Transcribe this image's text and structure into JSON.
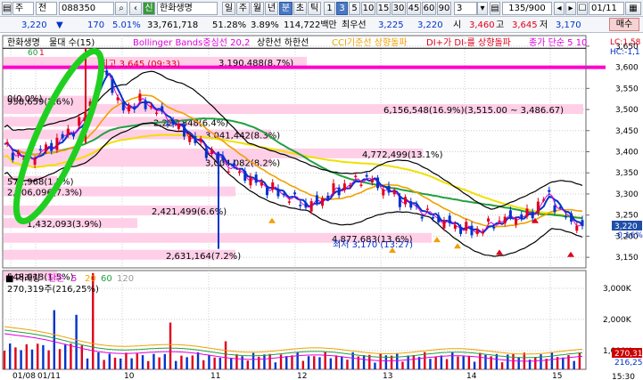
{
  "toolbar": {
    "market_type": "주",
    "period_select": "전",
    "stock_code": "088350",
    "stock_name": "한화생명",
    "period_buttons": [
      "일",
      "주",
      "월",
      "년",
      "분",
      "초",
      "틱"
    ],
    "interval_buttons": [
      "1",
      "3",
      "5",
      "10",
      "15",
      "30",
      "45",
      "60",
      "90"
    ],
    "active_interval": "3",
    "interval_value": "3",
    "count": "135/900",
    "date": "01/11",
    "price": "3,220",
    "change": "170",
    "change_pct": "5.01%",
    "volume": "33,761,718",
    "volume_ratio": "51.28%",
    "turnover": "3.89%",
    "amount": "114,722백만",
    "pref_label": "최우선",
    "ask": "3,225",
    "bid": "3,220",
    "open_label": "시",
    "open": "3,460",
    "high_label": "고",
    "high": "3,645",
    "low_label": "저",
    "low": "3,170",
    "buy_label": "매수"
  },
  "legend": {
    "name": "한화생명",
    "ma_label": "물대 수(15)",
    "ma_values": [
      "60",
      "1"
    ],
    "bollinger": "Bollinger Bands중심선 20,2",
    "upper_lower": "상한선 하한선",
    "cci": "CCI기준선 상향돌파",
    "dmi": "DI+가 DI-를 상향돌파",
    "close_ma": "종가 단순 5 10",
    "lc": "LC:1,58",
    "hc": "HC:-1,1"
  },
  "annotations": {
    "high_marker": "최고 3,645 (09:33)",
    "low_marker": "최저 3,170 (13:27)",
    "zero_label": "0(0.0%)",
    "volume_profile": [
      "3,190,488(8.7%)",
      "6,156,548(16.9%)(3,515.00 ~ 3,486.67)",
      "958,659(2.6%)",
      "2,227,848(6.4%)",
      "3,041,442(8.3%)",
      "4,772,499(13.1%)",
      "3,004,082(8.2%)",
      "572,968(1.5%)",
      "2,606,096(7.3%)",
      "2,421,499(6.6%)",
      "1,432,093(3.9%)",
      "4,877,683(13.6%)",
      "2,631,164(7.2%)",
      "548,013(1.5%)"
    ]
  },
  "volume_legend": {
    "title": "거래량",
    "ma": "단순",
    "periods": [
      "5",
      "20",
      "60",
      "120"
    ],
    "current": "270,319주(216,25%)"
  },
  "price_axis": [
    "3,650",
    "3,600",
    "3,550",
    "3,500",
    "3,450",
    "3,400",
    "3,350",
    "3,300",
    "3,250",
    "3,200",
    "3,150"
  ],
  "price_badges": {
    "current": "3,220",
    "change": "-0.16%"
  },
  "volume_axis": [
    "3,000K",
    "2,000K",
    "1,000K"
  ],
  "volume_badges": {
    "current": "270,31",
    "avg": "216,25"
  },
  "time_axis": [
    "01/08",
    "01/11",
    "10",
    "11",
    "12",
    "13",
    "14",
    "15"
  ],
  "time_corner": "15:30",
  "colors": {
    "up": "#e0001a",
    "down": "#0033cc",
    "magenta_line": "#ff00cc",
    "bollinger": "#000000",
    "ma5": "#e000e0",
    "ma20": "#f0a000",
    "ma60": "#20a040",
    "ma120": "#f0e000",
    "profile": "#ffcfe8",
    "highlight": "#20d020"
  }
}
